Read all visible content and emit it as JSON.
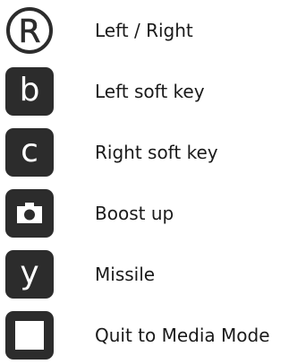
{
  "controls": [
    {
      "key_glyph": "R",
      "icon": "circled-r-icon",
      "label": "Left / Right"
    },
    {
      "key_glyph": "b",
      "icon": "b-key-icon",
      "label": "Left soft key"
    },
    {
      "key_glyph": "c",
      "icon": "c-key-icon",
      "label": "Right soft key"
    },
    {
      "key_glyph": "",
      "icon": "camera-key-icon",
      "label": "Boost up"
    },
    {
      "key_glyph": "y",
      "icon": "y-key-icon",
      "label": "Missile"
    },
    {
      "key_glyph": "",
      "icon": "stop-key-icon",
      "label": "Quit to Media Mode"
    }
  ],
  "colors": {
    "key_background": "#2c2c2c",
    "key_foreground": "#ffffff",
    "text": "#1a1a1a"
  }
}
